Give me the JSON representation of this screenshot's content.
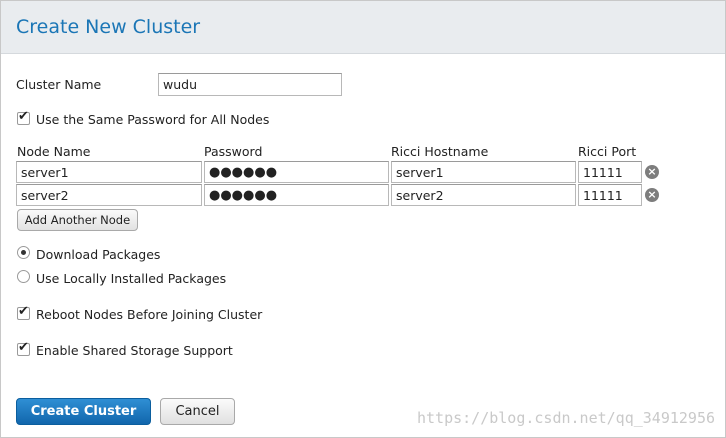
{
  "dialog": {
    "title": "Create New Cluster"
  },
  "cluster_name": {
    "label": "Cluster Name",
    "value": "wudu"
  },
  "same_password": {
    "label": "Use the Same Password for All Nodes",
    "checked": true
  },
  "nodes_table": {
    "columns": [
      "Node Name",
      "Password",
      "Ricci Hostname",
      "Ricci Port"
    ],
    "rows": [
      {
        "node_name": "server1",
        "password": "●●●●●●",
        "ricci_hostname": "server1",
        "ricci_port": "11111"
      },
      {
        "node_name": "server2",
        "password": "●●●●●●",
        "ricci_hostname": "server2",
        "ricci_port": "11111"
      }
    ],
    "remove_icon": "close-icon"
  },
  "add_node_button": {
    "label": "Add Another Node"
  },
  "package_options": {
    "download": {
      "label": "Download Packages",
      "selected": true
    },
    "local": {
      "label": "Use Locally Installed Packages",
      "selected": false
    }
  },
  "reboot_nodes": {
    "label": "Reboot Nodes Before Joining Cluster",
    "checked": true
  },
  "shared_storage": {
    "label": "Enable Shared Storage Support",
    "checked": true
  },
  "buttons": {
    "create": "Create Cluster",
    "cancel": "Cancel"
  },
  "watermark": "https://blog.csdn.net/qq_34912956",
  "colors": {
    "title": "#1b76b6",
    "primary_button": "#1a73b8",
    "header_bg": "#e9ecef"
  }
}
